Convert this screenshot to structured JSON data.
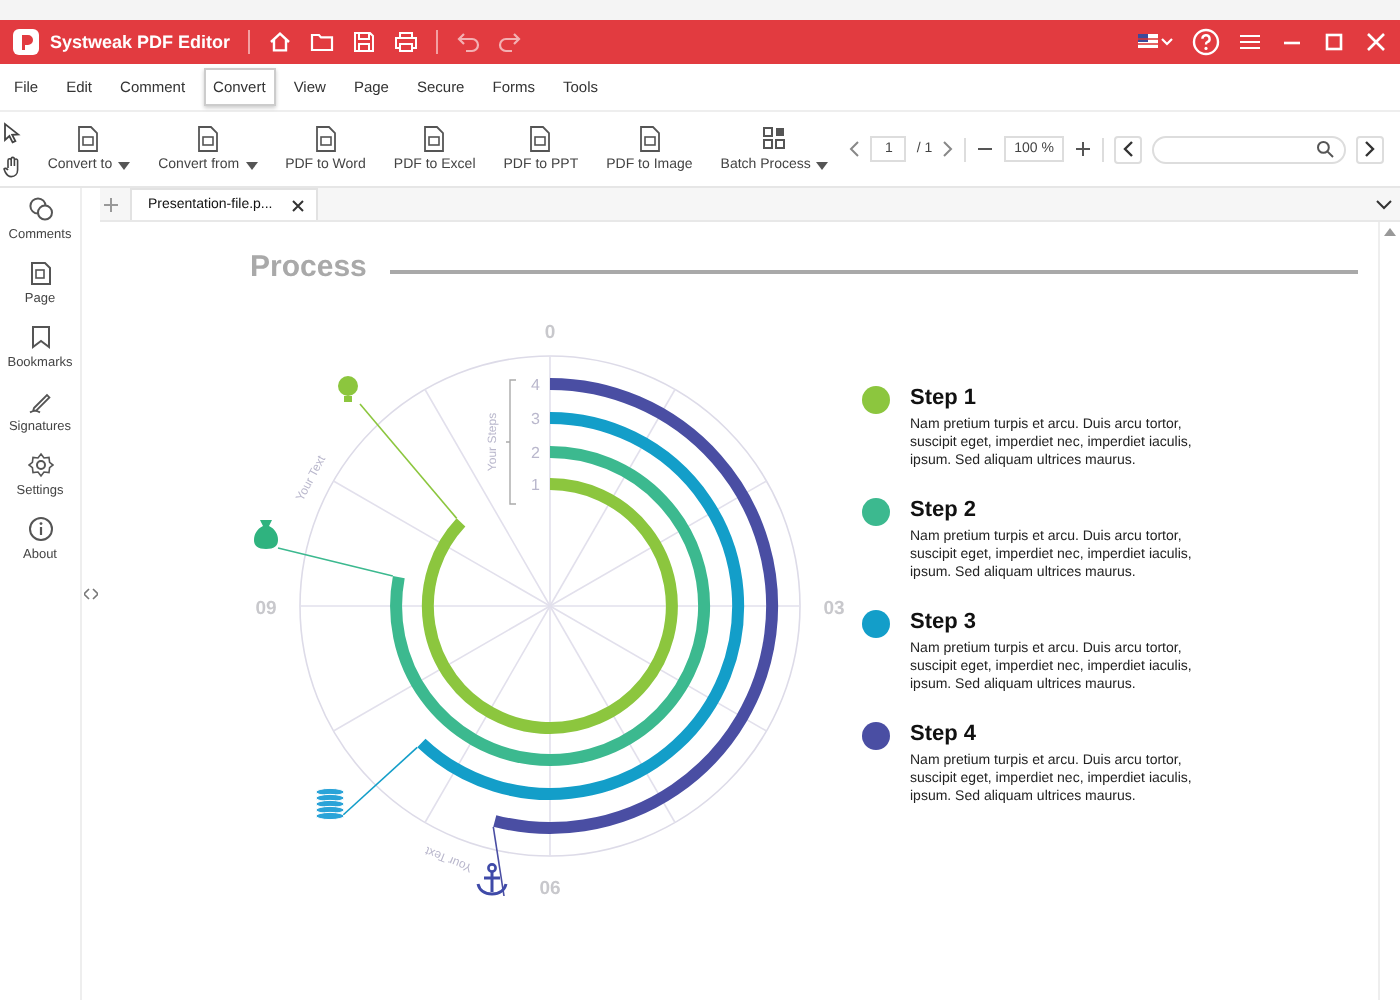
{
  "window": {
    "title": "Systweak PDF Editor"
  },
  "menu": [
    {
      "label": "File",
      "selected": false
    },
    {
      "label": "Edit",
      "selected": false
    },
    {
      "label": "Comment",
      "selected": false
    },
    {
      "label": "Convert",
      "selected": true
    },
    {
      "label": "View",
      "selected": false
    },
    {
      "label": "Page",
      "selected": false
    },
    {
      "label": "Secure",
      "selected": false
    },
    {
      "label": "Forms",
      "selected": false
    },
    {
      "label": "Tools",
      "selected": false
    }
  ],
  "toolbar": [
    {
      "label": "Convert to",
      "dropdown": true
    },
    {
      "label": "Convert from",
      "dropdown": true
    },
    {
      "label": "PDF to Word",
      "dropdown": false
    },
    {
      "label": "PDF to Excel",
      "dropdown": false
    },
    {
      "label": "PDF to PPT",
      "dropdown": false
    },
    {
      "label": "PDF to Image",
      "dropdown": false
    },
    {
      "label": "Batch Process",
      "dropdown": true
    }
  ],
  "page_nav": {
    "page": "1",
    "total": "/ 1",
    "zoom": "100 %"
  },
  "tabs": [
    {
      "label": "Presentation-file.p...",
      "selected": true
    }
  ],
  "sidebar": {
    "items": [
      {
        "label": "Comments"
      },
      {
        "label": "Page"
      },
      {
        "label": "Bookmarks"
      },
      {
        "label": "Signatures"
      },
      {
        "label": "Settings"
      },
      {
        "label": "About"
      }
    ]
  },
  "document": {
    "title": "Process",
    "diagram": {
      "axis_labels": [
        "0",
        "03",
        "06",
        "09"
      ],
      "steps_caption": "Your Steps",
      "arc_captions": [
        "Your Text",
        "Your Text"
      ],
      "rings": [
        {
          "label": "4",
          "color": "#4a4ea3"
        },
        {
          "label": "3",
          "color": "#139ec9"
        },
        {
          "label": "2",
          "color": "#3cb98f"
        },
        {
          "label": "1",
          "color": "#8cc63e"
        }
      ]
    },
    "steps": [
      {
        "title": "Step 1",
        "text": "Nam pretium turpis et arcu. Duis arcu tortor, suscipit eget, imperdiet nec, imperdiet iaculis, ipsum. Sed aliquam ultrices maurus.",
        "color": "#8cc63e"
      },
      {
        "title": "Step 2",
        "text": "Nam pretium turpis et arcu. Duis arcu tortor, suscipit eget, imperdiet nec, imperdiet iaculis, ipsum. Sed aliquam ultrices maurus.",
        "color": "#3cb98f"
      },
      {
        "title": "Step 3",
        "text": "Nam pretium turpis et arcu. Duis arcu tortor, suscipit eget, imperdiet nec, imperdiet iaculis, ipsum. Sed aliquam ultrices maurus.",
        "color": "#139ec9"
      },
      {
        "title": "Step 4",
        "text": "Nam pretium turpis et arcu. Duis arcu tortor, suscipit eget, imperdiet nec, imperdiet iaculis, ipsum. Sed aliquam ultrices maurus.",
        "color": "#4a4ea3"
      }
    ]
  }
}
